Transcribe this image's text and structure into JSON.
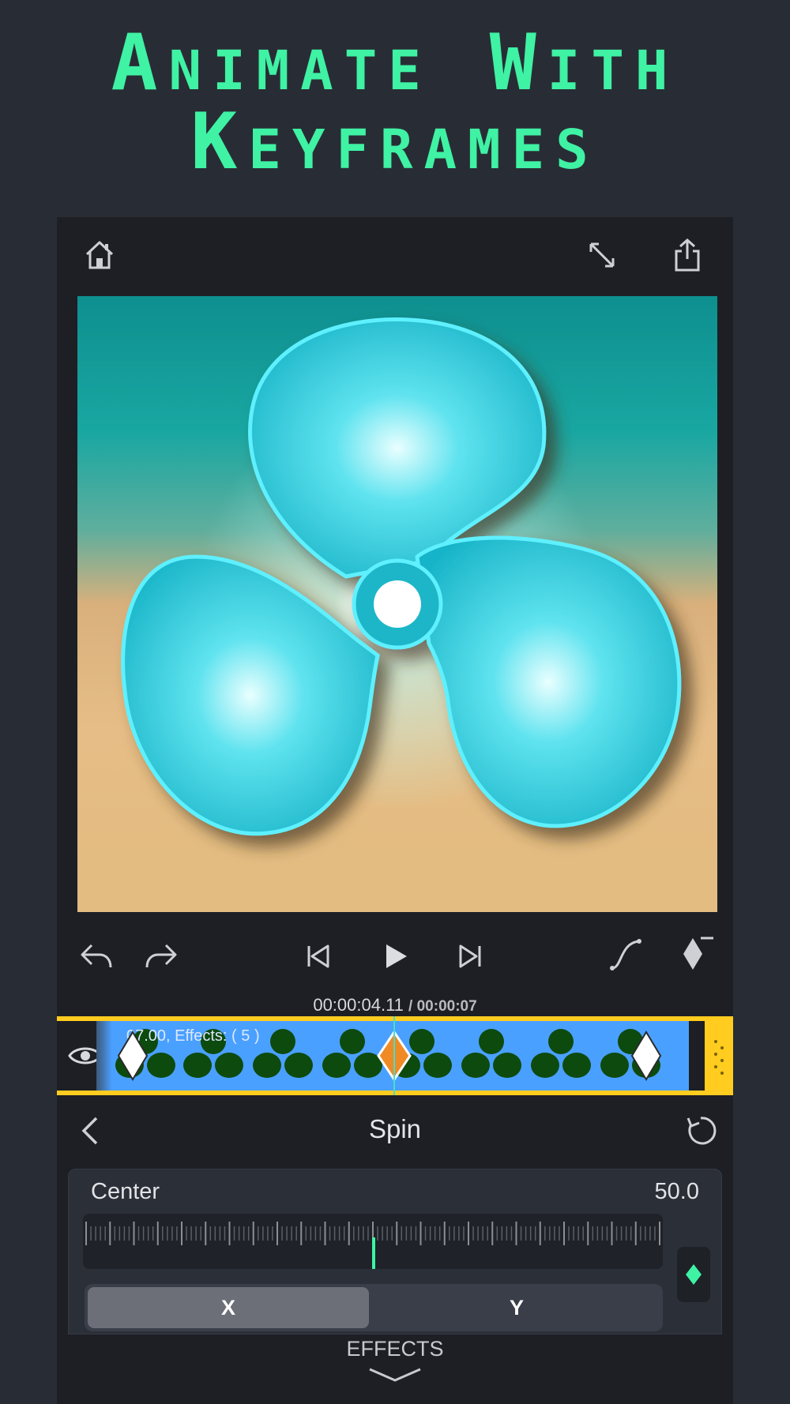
{
  "headline": {
    "line1": "Animate With",
    "line2": "Keyframes"
  },
  "toolbar": {
    "home_icon": "home-icon",
    "fullscreen_icon": "expand-icon",
    "share_icon": "share-icon"
  },
  "controls": {
    "undo_icon": "undo-icon",
    "redo_icon": "redo-icon",
    "skip_back_icon": "skip-back-icon",
    "play_icon": "play-icon",
    "skip_forward_icon": "skip-forward-icon",
    "curve_icon": "curve-icon",
    "keyframe_remove_icon": "keyframe-remove-icon"
  },
  "timeline": {
    "current_time": "00:00:04.11",
    "total_time": "/ 00:00:07",
    "clip_label": "07.00,  Effects: ( 5 )",
    "visibility_icon": "eye-icon",
    "accent": "#ffcc1f",
    "clip_color": "#4aa0ff"
  },
  "effect": {
    "title": "Spin",
    "back_icon": "chevron-left-icon",
    "reset_icon": "reset-icon",
    "param_label": "Center",
    "param_value": "50.0",
    "seg_x": "X",
    "seg_y": "Y"
  },
  "bottom_tab": {
    "label": "EFFECTS"
  },
  "colors": {
    "accent_green": "#3ff2a4",
    "background": "#282d35",
    "keyframe_active": "#f08a24"
  }
}
